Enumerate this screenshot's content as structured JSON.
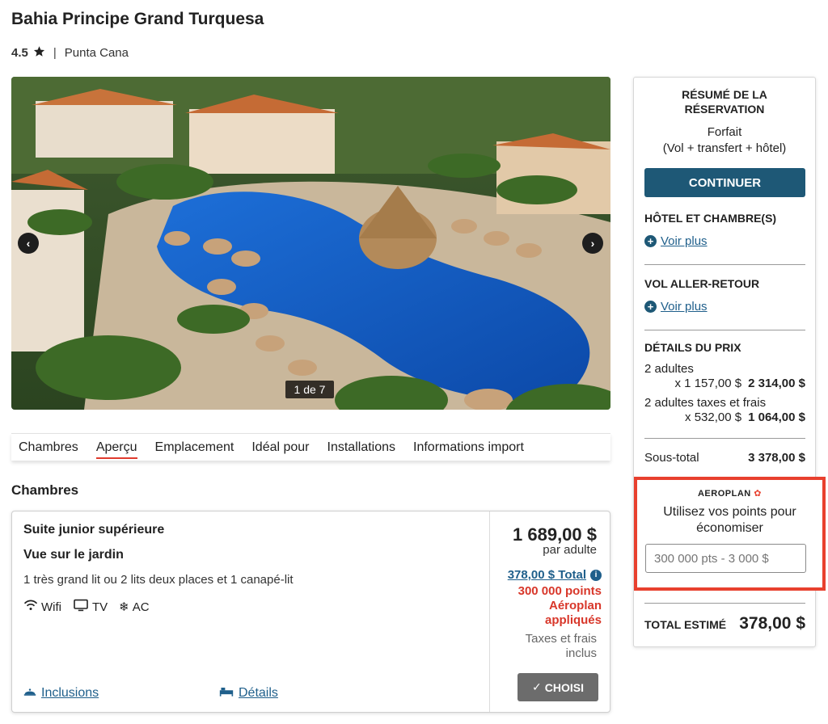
{
  "hotel": {
    "name": "Bahia Principe Grand Turquesa",
    "rating": "4.5",
    "location": "Punta Cana"
  },
  "gallery": {
    "counter": "1 de 7",
    "prev_icon": "chevron-left-icon",
    "next_icon": "chevron-right-icon"
  },
  "tabs": [
    {
      "label": "Chambres"
    },
    {
      "label": "Aperçu"
    },
    {
      "label": "Emplacement"
    },
    {
      "label": "Idéal pour"
    },
    {
      "label": "Installations"
    },
    {
      "label": "Informations import"
    }
  ],
  "active_tab": "Aperçu",
  "rooms_section": {
    "title": "Chambres"
  },
  "room": {
    "name": "Suite junior supérieure",
    "view": "Vue sur le jardin",
    "beds": "1 très grand lit ou 2 lits deux places et 1 canapé-lit",
    "amenities": [
      {
        "label": "Wifi",
        "icon": "wifi-icon"
      },
      {
        "label": "TV",
        "icon": "tv-icon"
      },
      {
        "label": "AC",
        "icon": "snowflake-icon"
      }
    ],
    "inclusions_link": "Inclusions",
    "details_link": "Détails",
    "price": "1 689,00 $",
    "price_unit": "par adulte",
    "total_link": "378,00 $ Total",
    "points_applied": "300 000 points Aéroplan appliqués",
    "taxes_note": "Taxes et frais inclus",
    "chosen_label": "CHOISI"
  },
  "summary": {
    "title": "RÉSUMÉ DE LA RÉSERVATION",
    "package_line1": "Forfait",
    "package_line2": "(Vol + transfert + hôtel)",
    "continue_label": "CONTINUER",
    "hotel_heading": "HÔTEL ET CHAMBRE(S)",
    "flight_heading": "VOL ALLER-RETOUR",
    "see_more": "Voir plus",
    "price_heading": "DÉTAILS DU PRIX",
    "lines": [
      {
        "label": "2 adultes",
        "unit": "x 1 157,00 $",
        "amount": "2 314,00 $"
      },
      {
        "label": "2 adultes taxes et frais",
        "unit": "x 532,00 $",
        "amount": "1 064,00 $"
      }
    ],
    "subtotal_label": "Sous-total",
    "subtotal_amount": "3 378,00 $",
    "aeroplan_logo": "AEROPLAN",
    "aeroplan_text": "Utilisez vos points pour économiser",
    "aeroplan_placeholder": "300 000 pts - 3 000 $",
    "total_label": "TOTAL ESTIMÉ",
    "total_amount": "378,00 $"
  },
  "colors": {
    "primary": "#1e5876",
    "link": "#1f5f8b",
    "accent_red": "#e8402e",
    "chosen_button": "#6c6c6c"
  }
}
